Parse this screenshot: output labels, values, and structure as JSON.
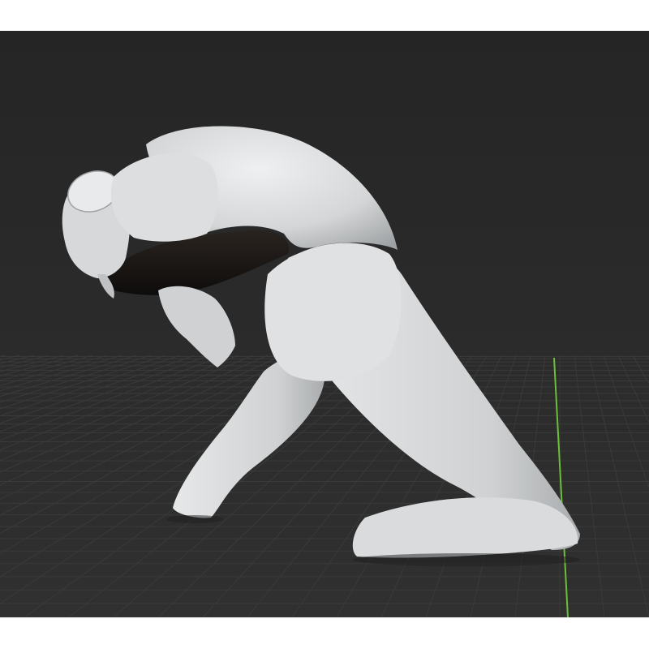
{
  "viewport": {
    "background_color": "#2b2b2b",
    "grid_visible": true,
    "grid_color": "#3a3a3a",
    "y_axis_color": "#6bbf3a",
    "model_color": "#d8dadb",
    "model_shadow_color": "#1a1715"
  }
}
